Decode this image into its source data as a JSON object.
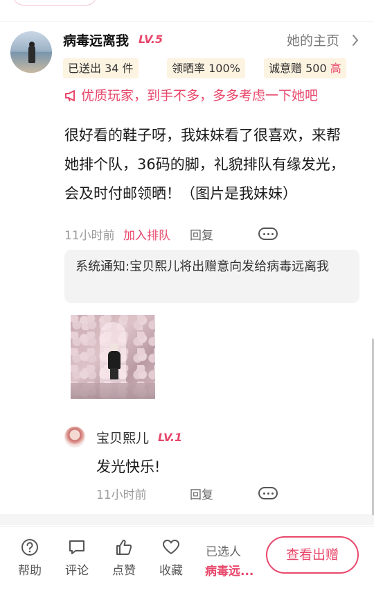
{
  "comment": {
    "username": "病毒远离我",
    "level": "LV.5",
    "homepage_link": "她的主页",
    "badges": [
      {
        "label": "已送出 34 件"
      },
      {
        "label": "领晒率 100%"
      },
      {
        "label": "诚意赠 500",
        "tag": "高"
      }
    ],
    "notice": "优质玩家，到手不多，多多考虑一下她吧",
    "text": "很好看的鞋子呀，我妹妹看了很喜欢，来帮她排个队，36码的脚，礼貌排队有缘发光，会及时付邮领晒！（图片是我妹妹）",
    "time": "11小时前",
    "join_queue": "加入排队",
    "reply_label": "回复",
    "system_notice": "系统通知:宝贝熙儿将出赠意向发给病毒远离我"
  },
  "reply": {
    "username": "宝贝熙儿",
    "level": "LV.1",
    "text": "发光快乐!",
    "time": "11小时前",
    "reply_label": "回复"
  },
  "bottom_bar": {
    "tabs": [
      {
        "label": "帮助",
        "icon": "help-icon"
      },
      {
        "label": "评论",
        "icon": "comment-icon"
      },
      {
        "label": "点赞",
        "icon": "like-icon"
      },
      {
        "label": "收藏",
        "icon": "favorite-icon"
      }
    ],
    "selected_label": "已选人",
    "selected_name": "病毒远...",
    "view_button": "查看出赠"
  },
  "colors": {
    "accent": "#e8476b",
    "badge_bg": "#fdf3e1",
    "system_bg": "#f3f3f3"
  }
}
